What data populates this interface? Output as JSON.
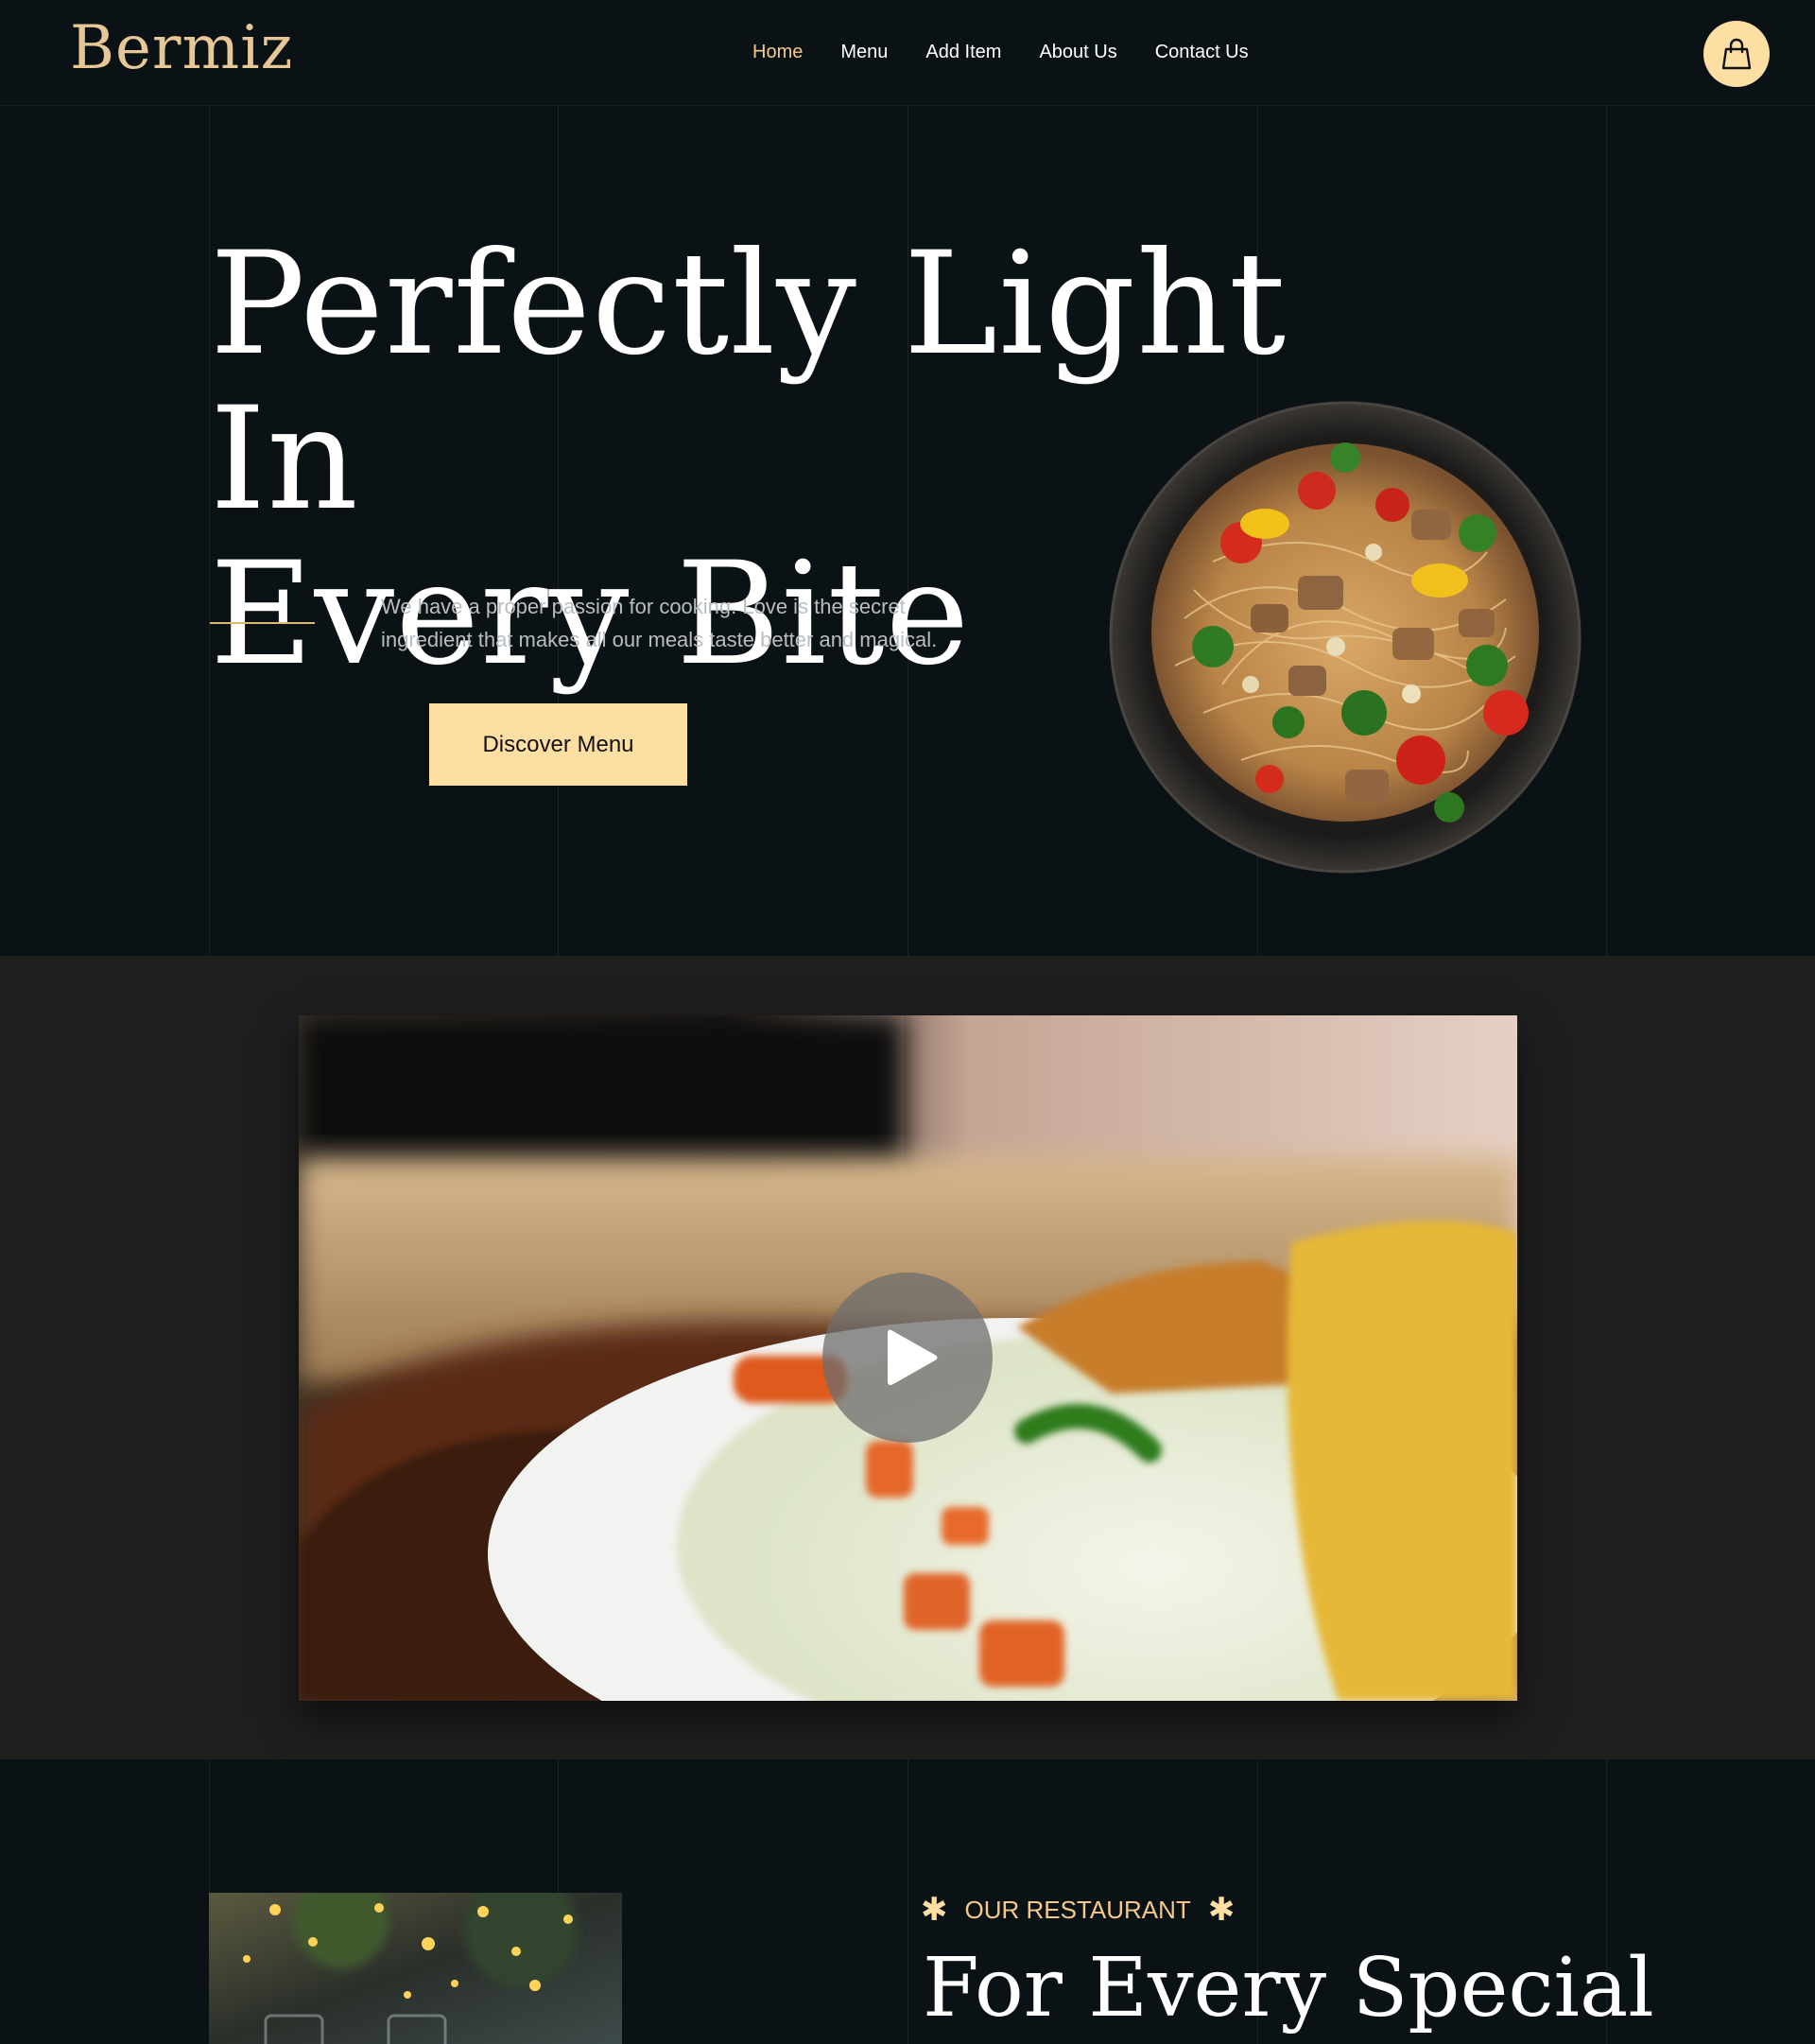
{
  "brand": {
    "logo_text": "Bermiz"
  },
  "nav": {
    "items": [
      {
        "label": "Home",
        "active": true
      },
      {
        "label": "Menu",
        "active": false
      },
      {
        "label": "Add Item",
        "active": false
      },
      {
        "label": "About Us",
        "active": false
      },
      {
        "label": "Contact Us",
        "active": false
      }
    ]
  },
  "cart": {
    "icon": "shopping-bag-icon"
  },
  "hero": {
    "title_line1": "Perfectly Light In",
    "title_line2": "Every Bite",
    "description": "We have a proper passion for cooking. Love is the secret ingredient that makes all our meals taste better and magical.",
    "cta_label": "Discover Menu"
  },
  "video": {
    "play_icon": "play-icon"
  },
  "restaurant": {
    "eyebrow": "OUR RESTAURANT",
    "eyebrow_icon": "asterisk-icon",
    "title": "For Every Special"
  },
  "colors": {
    "background": "#0b1215",
    "accent": "#fddea3",
    "accent_text": "#f5c98a",
    "video_section_bg": "#1f1f1f"
  }
}
